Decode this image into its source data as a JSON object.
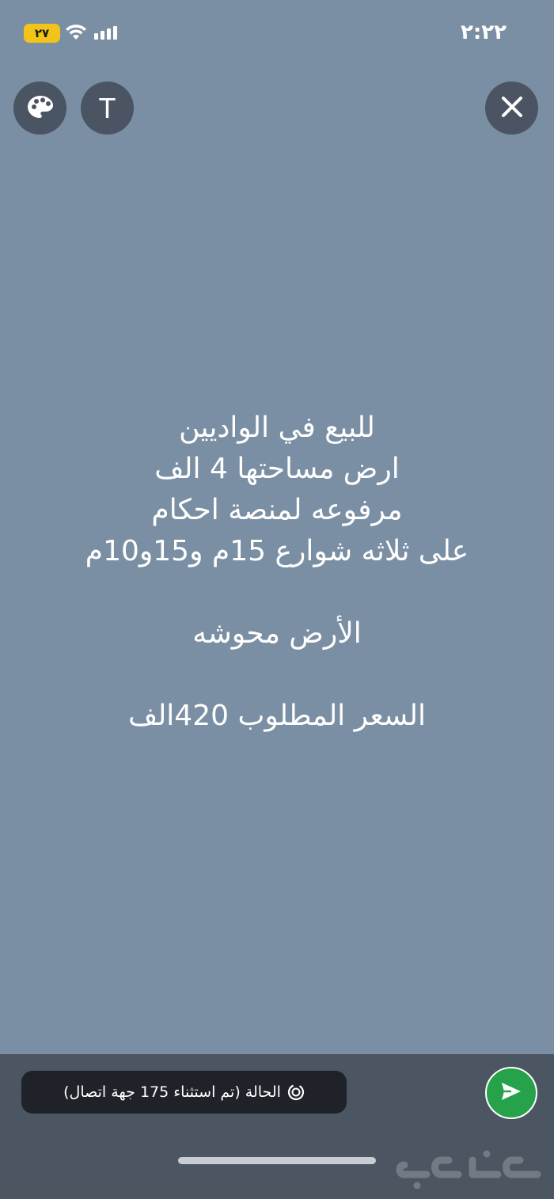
{
  "status_bar": {
    "time": "٢:٢٢",
    "battery_level": "٢٧"
  },
  "toolbar": {
    "palette_icon": "palette-icon",
    "text_label": "T",
    "close_icon": "close-icon"
  },
  "post": {
    "lines": [
      "للبيع في الواديين",
      "ارض مساحتها 4 الف",
      "مرفوعه لمنصة احكام",
      "على ثلاثه شوارع 15م و15و10م"
    ],
    "condition": "الأرض محوشه",
    "price": "السعر المطلوب 420الف"
  },
  "footer": {
    "audience_label": "الحالة (تم استثناء 175 جهة اتصال)",
    "send_icon": "send-icon"
  },
  "colors": {
    "background": "#7a8fa3",
    "bottom_bar": "#4c5562",
    "send_button": "#25a24a",
    "battery": "#f2c318"
  }
}
